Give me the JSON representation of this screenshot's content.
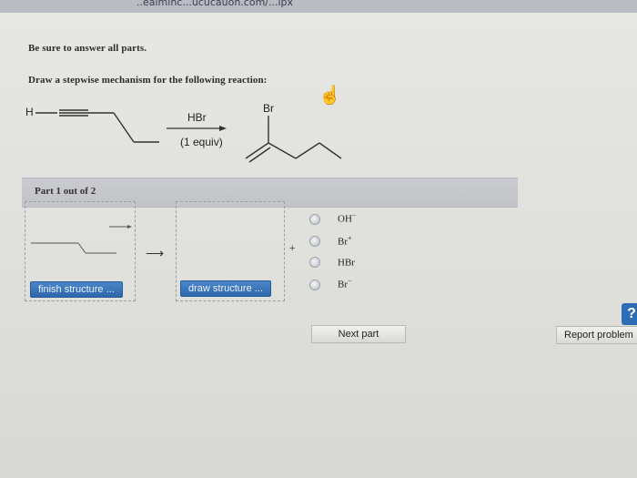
{
  "browser": {
    "url_fragment": "..ealminc...ucucauon.com/...ipx"
  },
  "instructions": {
    "line1": "Be sure to answer all parts.",
    "line2": "Draw a stepwise mechanism for the following reaction:"
  },
  "reaction": {
    "left_label": "H",
    "reagent_top": "HBr",
    "reagent_bottom": "(1 equiv)",
    "product_label": "Br"
  },
  "part": {
    "label": "Part 1 out of 2"
  },
  "workspace": {
    "finish_button": "finish structure ...",
    "draw_button": "draw structure ...",
    "plus": "+"
  },
  "options": [
    {
      "base": "OH",
      "sup": "−"
    },
    {
      "base": "Br",
      "sup": "+"
    },
    {
      "base": "HBr",
      "sup": ""
    },
    {
      "base": "Br",
      "sup": "−"
    }
  ],
  "footer": {
    "next_button": "Next part",
    "report_button": "Report problem",
    "help_symbol": "?"
  },
  "colors": {
    "accent": "#2e67ab",
    "header_bar": "#c5c7cc"
  },
  "icons": {
    "pointer": "hand-pointer-icon",
    "help": "help-icon"
  }
}
